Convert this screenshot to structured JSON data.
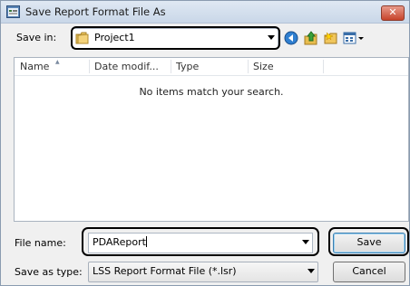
{
  "window": {
    "title": "Save Report Format File As",
    "close_label": "✕"
  },
  "toolbar": {
    "save_in_label": "Save in:",
    "location": "Project1",
    "icons": [
      "back-icon",
      "up-folder-icon",
      "new-folder-icon",
      "views-menu-icon"
    ]
  },
  "file_list": {
    "columns": [
      "Name",
      "Date modif...",
      "Type",
      "Size"
    ],
    "empty_message": "No items match your search."
  },
  "form": {
    "file_name_label": "File name:",
    "file_name_value": "PDAReport",
    "save_as_type_label": "Save as type:",
    "save_as_type_value": "LSS Report Format File (*.lsr)"
  },
  "buttons": {
    "save": "Save",
    "cancel": "Cancel"
  },
  "colors": {
    "title_bar": "#c9d7e8",
    "close": "#c7432a",
    "default_button_border": "#3c7fb1"
  }
}
